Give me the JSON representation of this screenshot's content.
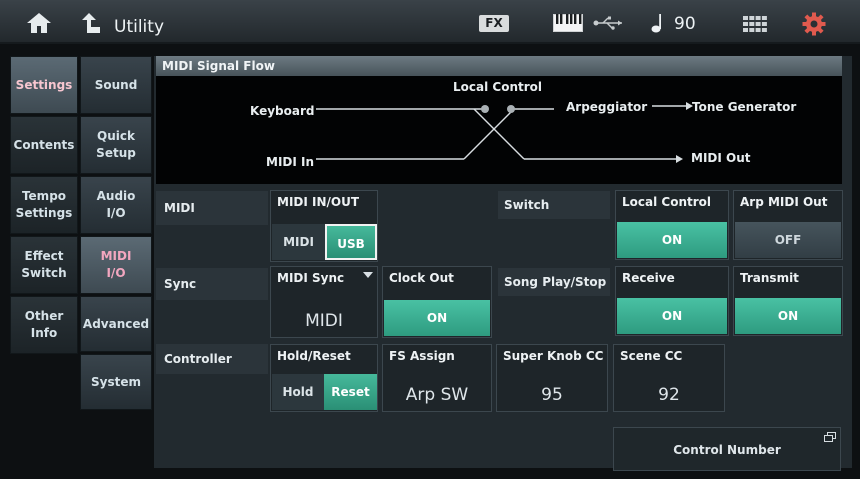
{
  "header": {
    "title": "Utility",
    "fx_label": "FX",
    "tempo": "90"
  },
  "left_tabs": [
    {
      "label": "Settings",
      "active": true
    },
    {
      "label": "Contents",
      "active": false
    },
    {
      "label": "Tempo\nSettings",
      "active": false
    },
    {
      "label": "Effect\nSwitch",
      "active": false
    },
    {
      "label": "Other\nInfo",
      "active": false
    }
  ],
  "sub_tabs": [
    {
      "label": "Sound",
      "active": false
    },
    {
      "label": "Quick\nSetup",
      "active": false
    },
    {
      "label": "Audio\nI/O",
      "active": false
    },
    {
      "label": "MIDI\nI/O",
      "active": true
    },
    {
      "label": "Advanced",
      "active": false
    },
    {
      "label": "System",
      "active": false
    }
  ],
  "signal_flow": {
    "title": "MIDI Signal Flow",
    "keyboard": "Keyboard",
    "local_control": "Local Control",
    "arpeggiator": "Arpeggiator",
    "tone_generator": "Tone Generator",
    "midi_in": "MIDI In",
    "midi_out": "MIDI Out"
  },
  "rows": {
    "midi": "MIDI",
    "sync": "Sync",
    "controller": "Controller",
    "switch": "Switch",
    "song_play_stop": "Song Play/Stop"
  },
  "midi_in_out": {
    "title": "MIDI IN/OUT",
    "options": [
      "MIDI",
      "USB"
    ],
    "selected": "USB"
  },
  "local_control": {
    "title": "Local Control",
    "value": "ON"
  },
  "arp_midi_out": {
    "title": "Arp MIDI Out",
    "value": "OFF"
  },
  "midi_sync": {
    "title": "MIDI Sync",
    "value": "MIDI"
  },
  "clock_out": {
    "title": "Clock Out",
    "value": "ON"
  },
  "receive": {
    "title": "Receive",
    "value": "ON"
  },
  "transmit": {
    "title": "Transmit",
    "value": "ON"
  },
  "hold_reset": {
    "title": "Hold/Reset",
    "options": [
      "Hold",
      "Reset"
    ],
    "selected": "Reset"
  },
  "fs_assign": {
    "title": "FS Assign",
    "value": "Arp SW"
  },
  "super_knob_cc": {
    "title": "Super Knob CC",
    "value": "95"
  },
  "scene_cc": {
    "title": "Scene CC",
    "value": "92"
  },
  "control_number": {
    "label": "Control Number"
  },
  "colors": {
    "accent_on": "#3fb596",
    "active_tab_text": "#f3a7c0"
  }
}
